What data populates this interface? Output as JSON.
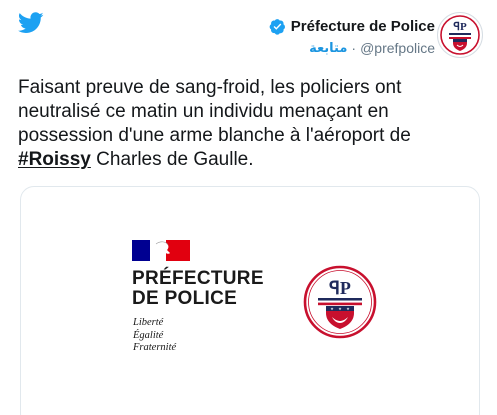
{
  "author": {
    "name": "Préfecture de Police",
    "handle": "@prefpolice",
    "separator": "·",
    "follow_label": "متابعة"
  },
  "tweet": {
    "text_before": "Faisant preuve de sang-froid, les policiers ont neutralisé ce matin un individu menaçant en possession d'une arme blanche à l'aéroport de ",
    "hashtag": "#Roissy",
    "text_after": " Charles de Gaulle."
  },
  "media": {
    "title_line1": "PRÉFECTURE",
    "title_line2": "DE POLICE",
    "motto_line1": "Liberté",
    "motto_line2": "Égalité",
    "motto_line3": "Fraternité",
    "seal_monogram": "ꟼP",
    "seal_alt": "seal-emblem"
  },
  "icons": {
    "twitter": "twitter-bird-icon",
    "verified": "verified-badge-icon",
    "marianne": "marianne-flag-icon"
  },
  "colors": {
    "twitter_blue": "#1da1f2",
    "link_blue": "#1b95e0",
    "text": "#14171a",
    "muted": "#657786",
    "border": "#e1e8ed",
    "republic_blue": "#000091",
    "republic_red": "#e1000f",
    "seal_red": "#c8102e",
    "seal_navy": "#1f2a5c"
  }
}
